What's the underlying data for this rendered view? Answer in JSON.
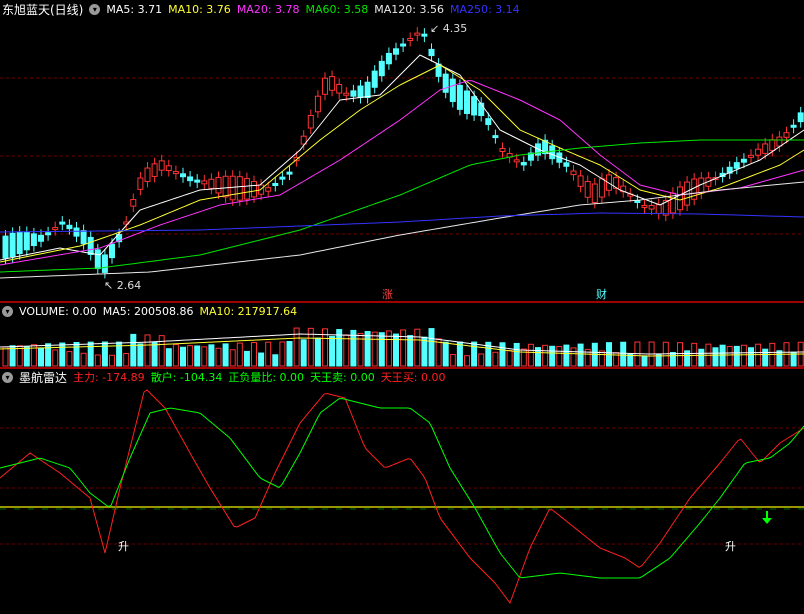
{
  "colors": {
    "ma5": "#ffffff",
    "ma10": "#ffff33",
    "ma20": "#ff33ff",
    "ma60": "#00e600",
    "ma120": "#e8e8e8",
    "ma250": "#3333ff",
    "up": "#ff3232",
    "down": "#54ffff",
    "main_force": "#ff2020",
    "retail": "#00ff00",
    "ratio": "#00ff00",
    "sell": "#00ff00",
    "buy": "#ff2020",
    "zero_line": "#c8c800",
    "signal_arrow": "#00ff00"
  },
  "price_panel": {
    "title": "东旭蓝天(日线)",
    "ma_labels": [
      {
        "text": "MA5: 3.71",
        "color": "#ffffff"
      },
      {
        "text": "MA10: 3.76",
        "color": "#ffff33"
      },
      {
        "text": "MA20: 3.78",
        "color": "#ff33ff"
      },
      {
        "text": "MA60: 3.58",
        "color": "#00e600"
      },
      {
        "text": "MA120: 3.56",
        "color": "#e8e8e8"
      },
      {
        "text": "MA250: 3.14",
        "color": "#3333ff"
      }
    ],
    "high_label": "4.35",
    "low_label": "2.64",
    "marker_zhang": "涨",
    "marker_cai": "财"
  },
  "volume_panel": {
    "labels": [
      {
        "text": "VOLUME: 0.00",
        "color": "#ffffff"
      },
      {
        "text": "MA5: 200508.86",
        "color": "#ffffff"
      },
      {
        "text": "MA10: 217917.64",
        "color": "#ffff33"
      }
    ]
  },
  "radar_panel": {
    "title": "墨航雷达",
    "labels": [
      {
        "text": "主力: -174.89",
        "color": "#ff2020"
      },
      {
        "text": "散户: -104.34",
        "color": "#00ff00"
      },
      {
        "text": "正负量比: 0.00",
        "color": "#00ff00"
      },
      {
        "text": "天王卖: 0.00",
        "color": "#00ff00"
      },
      {
        "text": "天王买: 0.00",
        "color": "#ff2020"
      }
    ],
    "signal_labels": [
      "升",
      "升"
    ]
  }
}
